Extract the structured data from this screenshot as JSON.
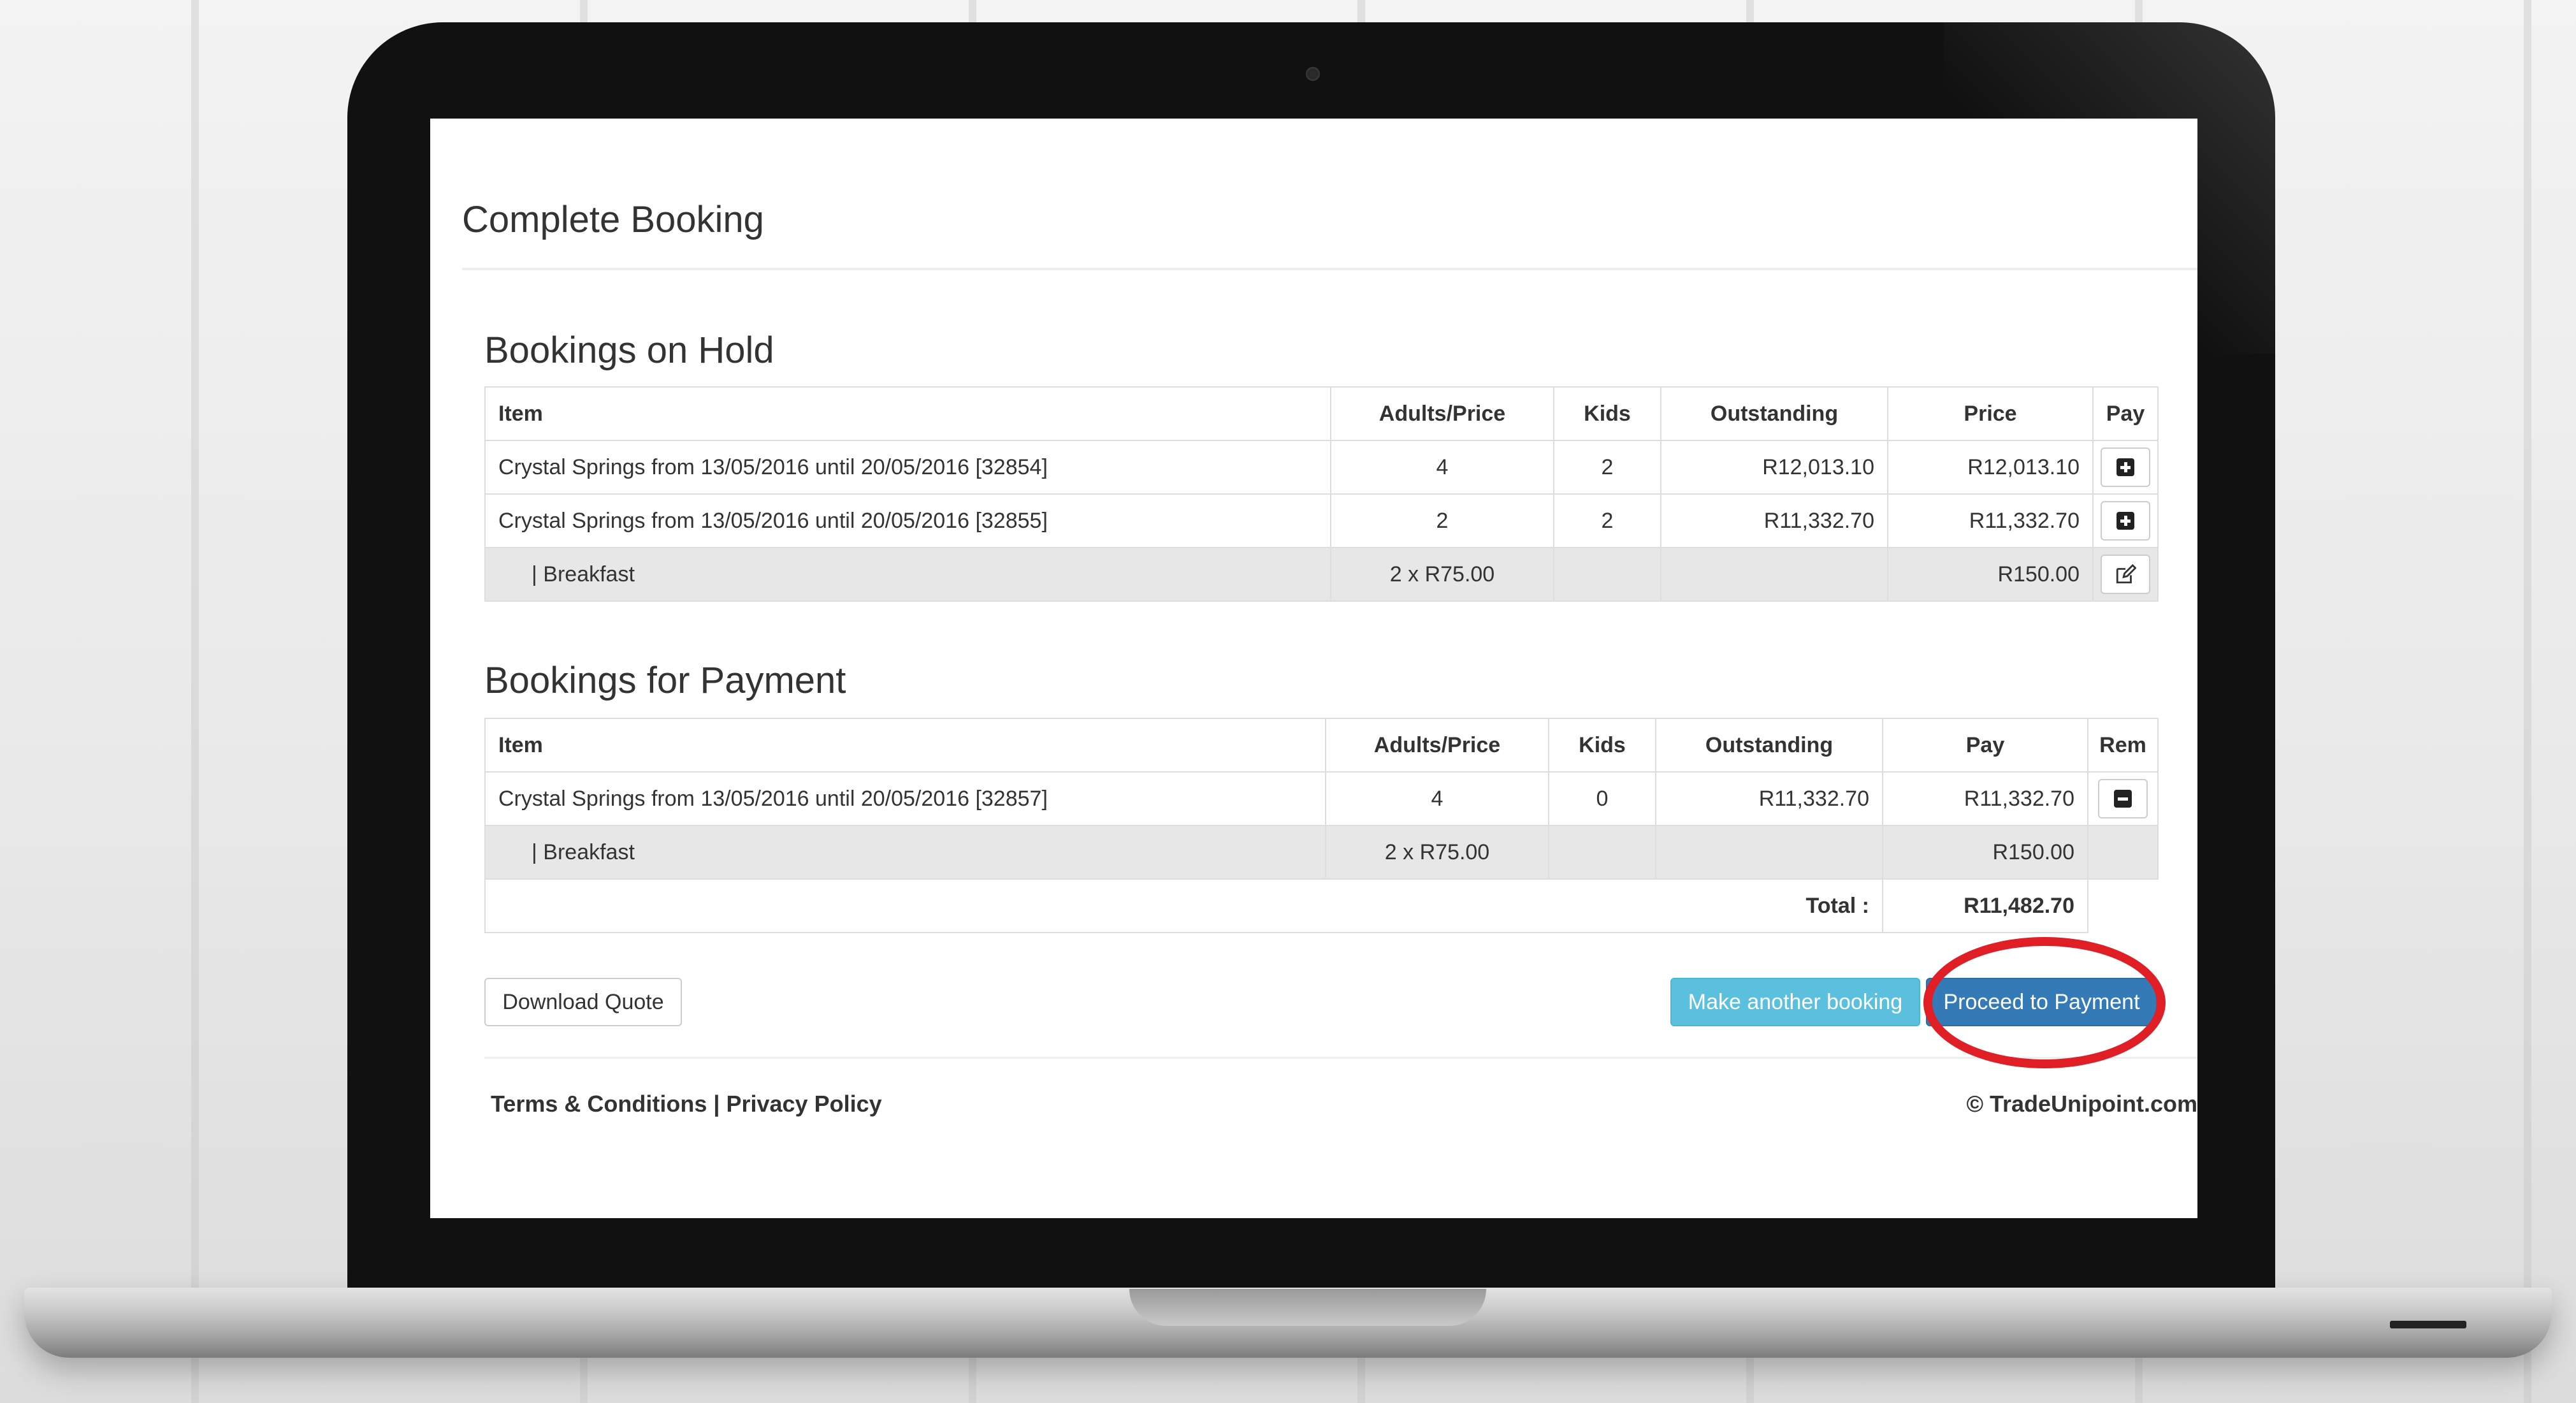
{
  "page": {
    "title": "Complete Booking"
  },
  "hold": {
    "title": "Bookings on Hold",
    "headers": [
      "Item",
      "Adults/Price",
      "Kids",
      "Outstanding",
      "Price",
      "Pay"
    ],
    "rows": [
      {
        "item": "Crystal Springs from 13/05/2016 until 20/05/2016 [32854]",
        "adults": "4",
        "kids": "2",
        "outstanding": "R12,013.10",
        "price": "R12,013.10",
        "action_icon": "plus-square-icon"
      },
      {
        "item": "Crystal Springs from 13/05/2016 until 20/05/2016 [32855]",
        "adults": "2",
        "kids": "2",
        "outstanding": "R11,332.70",
        "price": "R11,332.70",
        "action_icon": "plus-square-icon"
      },
      {
        "item": "| Breakfast",
        "adults": "2 x R75.00",
        "kids": "",
        "outstanding": "",
        "price": "R150.00",
        "action_icon": "edit-icon"
      }
    ]
  },
  "payment": {
    "title": "Bookings for Payment",
    "headers": [
      "Item",
      "Adults/Price",
      "Kids",
      "Outstanding",
      "Pay",
      "Rem"
    ],
    "rows": [
      {
        "item": "Crystal Springs from 13/05/2016 until 20/05/2016 [32857]",
        "adults": "4",
        "kids": "0",
        "outstanding": "R11,332.70",
        "pay": "R11,332.70",
        "action_icon": "minus-square-icon"
      },
      {
        "item": "| Breakfast",
        "adults": "2 x R75.00",
        "kids": "",
        "outstanding": "",
        "pay": "R150.00",
        "action_icon": ""
      }
    ],
    "total_label": "Total :",
    "total_value": "R11,482.70"
  },
  "actions": {
    "download_quote": "Download Quote",
    "make_another": "Make another booking",
    "proceed": "Proceed to Payment"
  },
  "footer": {
    "terms": "Terms & Conditions",
    "separator": "|",
    "privacy": "Privacy Policy",
    "copyright": "© TradeUnipoint.com"
  },
  "colors": {
    "primary": "#337ab7",
    "info": "#5bc0de",
    "highlight_ring": "#e01e25"
  }
}
